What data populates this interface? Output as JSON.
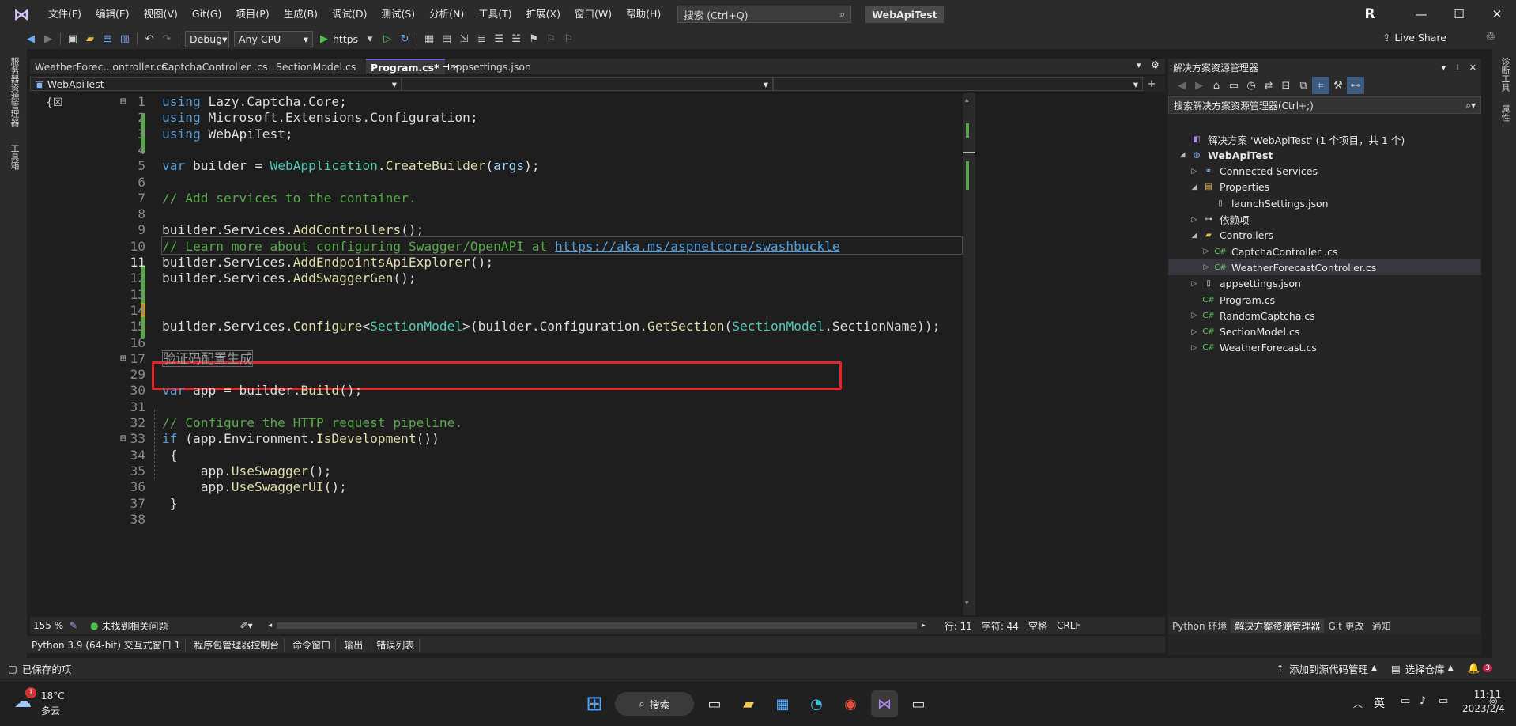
{
  "titlebar": {
    "menus": [
      "文件(F)",
      "编辑(E)",
      "视图(V)",
      "Git(G)",
      "项目(P)",
      "生成(B)",
      "调试(D)",
      "测试(S)",
      "分析(N)",
      "工具(T)",
      "扩展(X)",
      "窗口(W)",
      "帮助(H)"
    ],
    "search_placeholder": "搜索 (Ctrl+Q)",
    "solution": "WebApiTest",
    "avatar": "R"
  },
  "toolbar": {
    "config": "Debug",
    "platform": "Any CPU",
    "run_label": "https",
    "live_share": "Live Share"
  },
  "left_strip": {
    "server_explorer": "服务器资源管理器",
    "toolbox": "工具箱"
  },
  "right_strip": {
    "diag": "诊断工具",
    "props": "属性"
  },
  "doc_tabs": [
    "WeatherForec...ontroller.cs",
    "CaptchaController .cs",
    "SectionModel.cs",
    "Program.cs*",
    "appsettings.json"
  ],
  "nav": {
    "project": "WebApiTest"
  },
  "editor": {
    "lines": [
      {
        "n": "1",
        "tokens": [
          [
            "kw",
            "using"
          ],
          [
            "id",
            " Lazy.Captcha.Core;"
          ]
        ]
      },
      {
        "n": "2",
        "tokens": [
          [
            "kw",
            "using"
          ],
          [
            "id",
            " Microsoft.Extensions.Configuration;"
          ]
        ]
      },
      {
        "n": "3",
        "tokens": [
          [
            "kw",
            "using"
          ],
          [
            "id",
            " WebApiTest;"
          ]
        ]
      },
      {
        "n": "4",
        "tokens": []
      },
      {
        "n": "5",
        "tokens": [
          [
            "kw",
            "var"
          ],
          [
            "id",
            " builder = "
          ],
          [
            "ty",
            "WebApplication"
          ],
          [
            "id",
            "."
          ],
          [
            "fn",
            "CreateBuilder"
          ],
          [
            "id",
            "("
          ],
          [
            "pm",
            "args"
          ],
          [
            "id",
            ");"
          ]
        ]
      },
      {
        "n": "6",
        "tokens": []
      },
      {
        "n": "7",
        "tokens": [
          [
            "cm",
            "// Add services to the container."
          ]
        ]
      },
      {
        "n": "8",
        "tokens": []
      },
      {
        "n": "9",
        "tokens": [
          [
            "id",
            "builder.Services."
          ],
          [
            "fn",
            "AddControllers"
          ],
          [
            "id",
            "();"
          ]
        ]
      },
      {
        "n": "10",
        "tokens": [
          [
            "cm",
            "// Learn more about configuring Swagger/OpenAPI at "
          ],
          [
            "lk",
            "https://aka.ms/aspnetcore/swashbuckle"
          ]
        ]
      },
      {
        "n": "11",
        "tokens": [
          [
            "id",
            "builder.Services."
          ],
          [
            "fn",
            "AddEndpointsApiExplorer"
          ],
          [
            "id",
            "();"
          ]
        ]
      },
      {
        "n": "12",
        "tokens": [
          [
            "id",
            "builder.Services."
          ],
          [
            "fn",
            "AddSwaggerGen"
          ],
          [
            "id",
            "();"
          ]
        ]
      },
      {
        "n": "13",
        "tokens": []
      },
      {
        "n": "14",
        "tokens": []
      },
      {
        "n": "15",
        "tokens": [
          [
            "id",
            "builder.Services."
          ],
          [
            "fn",
            "Configure"
          ],
          [
            "id",
            "<"
          ],
          [
            "ty",
            "SectionModel"
          ],
          [
            "id",
            ">(builder.Configuration."
          ],
          [
            "fn",
            "GetSection"
          ],
          [
            "id",
            "("
          ],
          [
            "ty",
            "SectionModel"
          ],
          [
            "id",
            ".SectionName));"
          ]
        ]
      },
      {
        "n": "16",
        "tokens": []
      },
      {
        "n": "17",
        "tokens": [
          [
            "region",
            "验证码配置生成"
          ]
        ]
      },
      {
        "n": "29",
        "tokens": []
      },
      {
        "n": "30",
        "tokens": [
          [
            "kw",
            "var"
          ],
          [
            "id",
            " app = builder."
          ],
          [
            "fn",
            "Build"
          ],
          [
            "id",
            "();"
          ]
        ]
      },
      {
        "n": "31",
        "tokens": []
      },
      {
        "n": "32",
        "tokens": [
          [
            "cm",
            "// Configure the HTTP request pipeline."
          ]
        ]
      },
      {
        "n": "33",
        "tokens": [
          [
            "kw",
            "if"
          ],
          [
            "id",
            " (app.Environment."
          ],
          [
            "fn",
            "IsDevelopment"
          ],
          [
            "id",
            "())"
          ]
        ]
      },
      {
        "n": "34",
        "tokens": [
          [
            "id",
            " {"
          ]
        ]
      },
      {
        "n": "35",
        "tokens": [
          [
            "id",
            "     app."
          ],
          [
            "fn",
            "UseSwagger"
          ],
          [
            "id",
            "();"
          ]
        ]
      },
      {
        "n": "36",
        "tokens": [
          [
            "id",
            "     app."
          ],
          [
            "fn",
            "UseSwaggerUI"
          ],
          [
            "id",
            "();"
          ]
        ]
      },
      {
        "n": "37",
        "tokens": [
          [
            "id",
            " }"
          ]
        ]
      },
      {
        "n": "38",
        "tokens": []
      }
    ]
  },
  "editor_status": {
    "zoom": "155 %",
    "issues": "未找到相关问题",
    "row": "行: 11",
    "col": "字符: 44",
    "space": "空格",
    "eol": "CRLF"
  },
  "bottom_tabs": [
    "Python 3.9 (64-bit) 交互式窗口 1",
    "程序包管理器控制台",
    "命令窗口",
    "输出",
    "错误列表"
  ],
  "solution_explorer": {
    "title": "解决方案资源管理器",
    "search": "搜索解决方案资源管理器(Ctrl+;)",
    "items": [
      {
        "label": "解决方案 'WebApiTest' (1 个项目，共 1 个)",
        "depth": 0,
        "tw": "",
        "icon": "sol"
      },
      {
        "label": "WebApiTest",
        "depth": 0,
        "tw": "◢",
        "icon": "proj",
        "bold": true
      },
      {
        "label": "Connected Services",
        "depth": 1,
        "tw": "▷",
        "icon": "conn"
      },
      {
        "label": "Properties",
        "depth": 1,
        "tw": "◢",
        "icon": "prop"
      },
      {
        "label": "launchSettings.json",
        "depth": 2,
        "tw": "",
        "icon": "json"
      },
      {
        "label": "依赖项",
        "depth": 1,
        "tw": "▷",
        "icon": "dep"
      },
      {
        "label": "Controllers",
        "depth": 1,
        "tw": "◢",
        "icon": "folder"
      },
      {
        "label": "CaptchaController .cs",
        "depth": 2,
        "tw": "▷",
        "icon": "cs"
      },
      {
        "label": "WeatherForecastController.cs",
        "depth": 2,
        "tw": "▷",
        "icon": "cs",
        "selected": true
      },
      {
        "label": "appsettings.json",
        "depth": 1,
        "tw": "▷",
        "icon": "json"
      },
      {
        "label": "Program.cs",
        "depth": 1,
        "tw": "",
        "icon": "cs"
      },
      {
        "label": "RandomCaptcha.cs",
        "depth": 1,
        "tw": "▷",
        "icon": "cs"
      },
      {
        "label": "SectionModel.cs",
        "depth": 1,
        "tw": "▷",
        "icon": "cs"
      },
      {
        "label": "WeatherForecast.cs",
        "depth": 1,
        "tw": "▷",
        "icon": "cs"
      }
    ],
    "tabs": [
      "Python 环境",
      "解决方案资源管理器",
      "Git 更改",
      "通知"
    ]
  },
  "statusbar": {
    "saved": "已保存的项",
    "add_source": "添加到源代码管理",
    "select_repo": "选择仓库",
    "bell_count": "3"
  },
  "taskbar": {
    "temp": "18°C",
    "weather": "多云",
    "weather_badge": "1",
    "search": "搜索",
    "ime": "英",
    "time": "11:11",
    "date": "2023/2/4"
  },
  "colors": {
    "accent": "#7160e8",
    "highlight_box": "#e8242a",
    "added_bar": "#57a64a"
  }
}
